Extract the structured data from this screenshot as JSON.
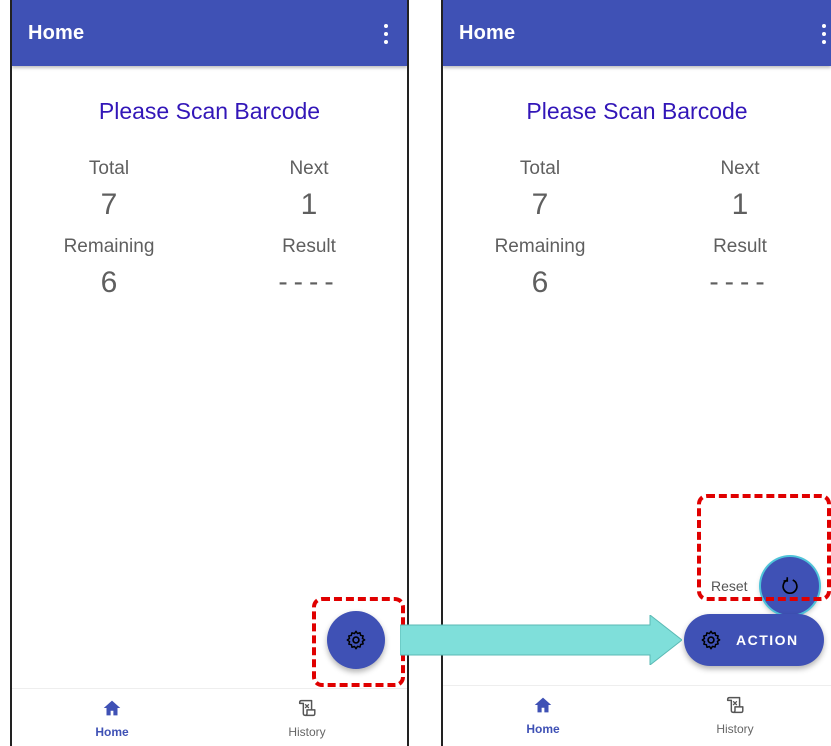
{
  "screens": {
    "left": {
      "appbar_title": "Home",
      "scan_title": "Please Scan Barcode",
      "stats": {
        "total_label": "Total",
        "total_value": "7",
        "next_label": "Next",
        "next_value": "1",
        "remaining_label": "Remaining",
        "remaining_value": "6",
        "result_label": "Result",
        "result_value": "----"
      },
      "fab_icon": "gear-icon",
      "nav": {
        "home": "Home",
        "history": "History"
      }
    },
    "right": {
      "appbar_title": "Home",
      "scan_title": "Please Scan Barcode",
      "stats": {
        "total_label": "Total",
        "total_value": "7",
        "next_label": "Next",
        "next_value": "1",
        "remaining_label": "Remaining",
        "remaining_value": "6",
        "result_label": "Result",
        "result_value": "----"
      },
      "reset_label": "Reset",
      "reset_icon": "refresh-icon",
      "action_label": "ACTION",
      "action_icon": "gear-icon",
      "nav": {
        "home": "Home",
        "history": "History"
      }
    }
  },
  "colors": {
    "appbar": "#3f51b5",
    "title_text": "#3216b8",
    "highlight_border": "#e00000",
    "arrow": "#7fdfda"
  }
}
